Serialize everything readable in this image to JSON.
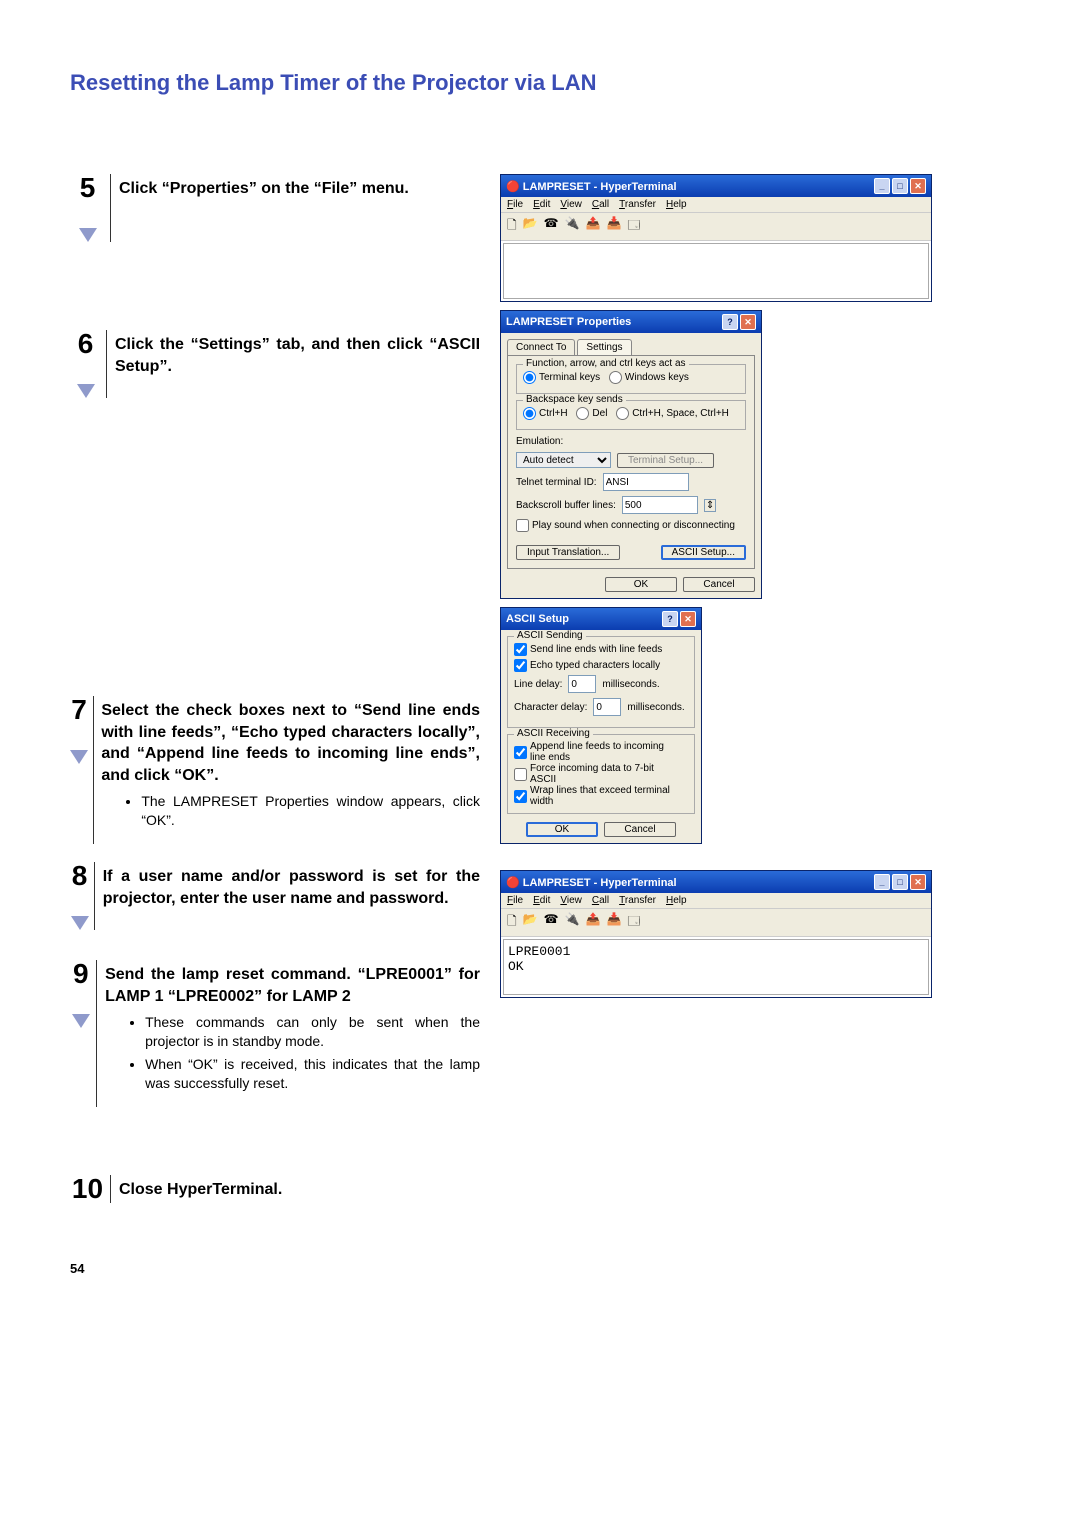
{
  "page_heading": "Resetting the Lamp Timer of the Projector via LAN",
  "page_number": "54",
  "steps": {
    "s5": {
      "num": "5",
      "text": "Click “Properties” on the “File” menu."
    },
    "s6": {
      "num": "6",
      "text": "Click the “Settings” tab, and then click “ASCII Setup”."
    },
    "s7": {
      "num": "7",
      "text": "Select the check boxes next to “Send line ends with line feeds”, “Echo typed characters locally”, and “Append line feeds to incoming line ends”, and click “OK”.",
      "sub1": "The LAMPRESET Properties window appears, click “OK”."
    },
    "s8": {
      "num": "8",
      "text": "If a user name and/or password is set for the projector, enter the user name and password."
    },
    "s9": {
      "num": "9",
      "text": "Send the lamp reset command. “LPRE0001” for LAMP 1 “LPRE0002” for LAMP 2",
      "sub1": "These commands can only be sent when the projector is in standby mode.",
      "sub2": "When “OK” is received, this indicates that the lamp was successfully reset."
    },
    "s10": {
      "num": "10",
      "text": "Close HyperTerminal."
    }
  },
  "ht1": {
    "title": "LAMPRESET - HyperTerminal",
    "menu": {
      "file": "File",
      "edit": "Edit",
      "view": "View",
      "call": "Call",
      "transfer": "Transfer",
      "help": "Help"
    }
  },
  "props": {
    "title": "LAMPRESET Properties",
    "tab_connect": "Connect To",
    "tab_settings": "Settings",
    "group_keys": "Function, arrow, and ctrl keys act as",
    "opt_terminal": "Terminal keys",
    "opt_windows": "Windows keys",
    "group_bksp": "Backspace key sends",
    "opt_ctrlh": "Ctrl+H",
    "opt_del": "Del",
    "opt_ctrlh_space": "Ctrl+H, Space, Ctrl+H",
    "lbl_emulation": "Emulation:",
    "val_emulation": "Auto detect",
    "btn_terminal_setup": "Terminal Setup...",
    "lbl_telnet": "Telnet terminal ID:",
    "val_telnet": "ANSI",
    "lbl_backscroll": "Backscroll buffer lines:",
    "val_backscroll": "500",
    "chk_play_sound": "Play sound when connecting or disconnecting",
    "btn_input_trans": "Input Translation...",
    "btn_ascii_setup": "ASCII Setup...",
    "btn_ok": "OK",
    "btn_cancel": "Cancel"
  },
  "ascii": {
    "title": "ASCII Setup",
    "section_send": "ASCII Sending",
    "chk_send_le": "Send line ends with line feeds",
    "chk_echo": "Echo typed characters locally",
    "lbl_line_delay": "Line delay:",
    "val_line_delay": "0",
    "unit_ms": "milliseconds.",
    "lbl_char_delay": "Character delay:",
    "val_char_delay": "0",
    "section_recv": "ASCII Receiving",
    "chk_append": "Append line feeds to incoming line ends",
    "chk_force7": "Force incoming data to 7-bit ASCII",
    "chk_wrap": "Wrap lines that exceed terminal width",
    "btn_ok": "OK",
    "btn_cancel": "Cancel"
  },
  "ht2": {
    "title": "LAMPRESET - HyperTerminal",
    "body_line1": "LPRE0001",
    "body_line2": "OK"
  }
}
